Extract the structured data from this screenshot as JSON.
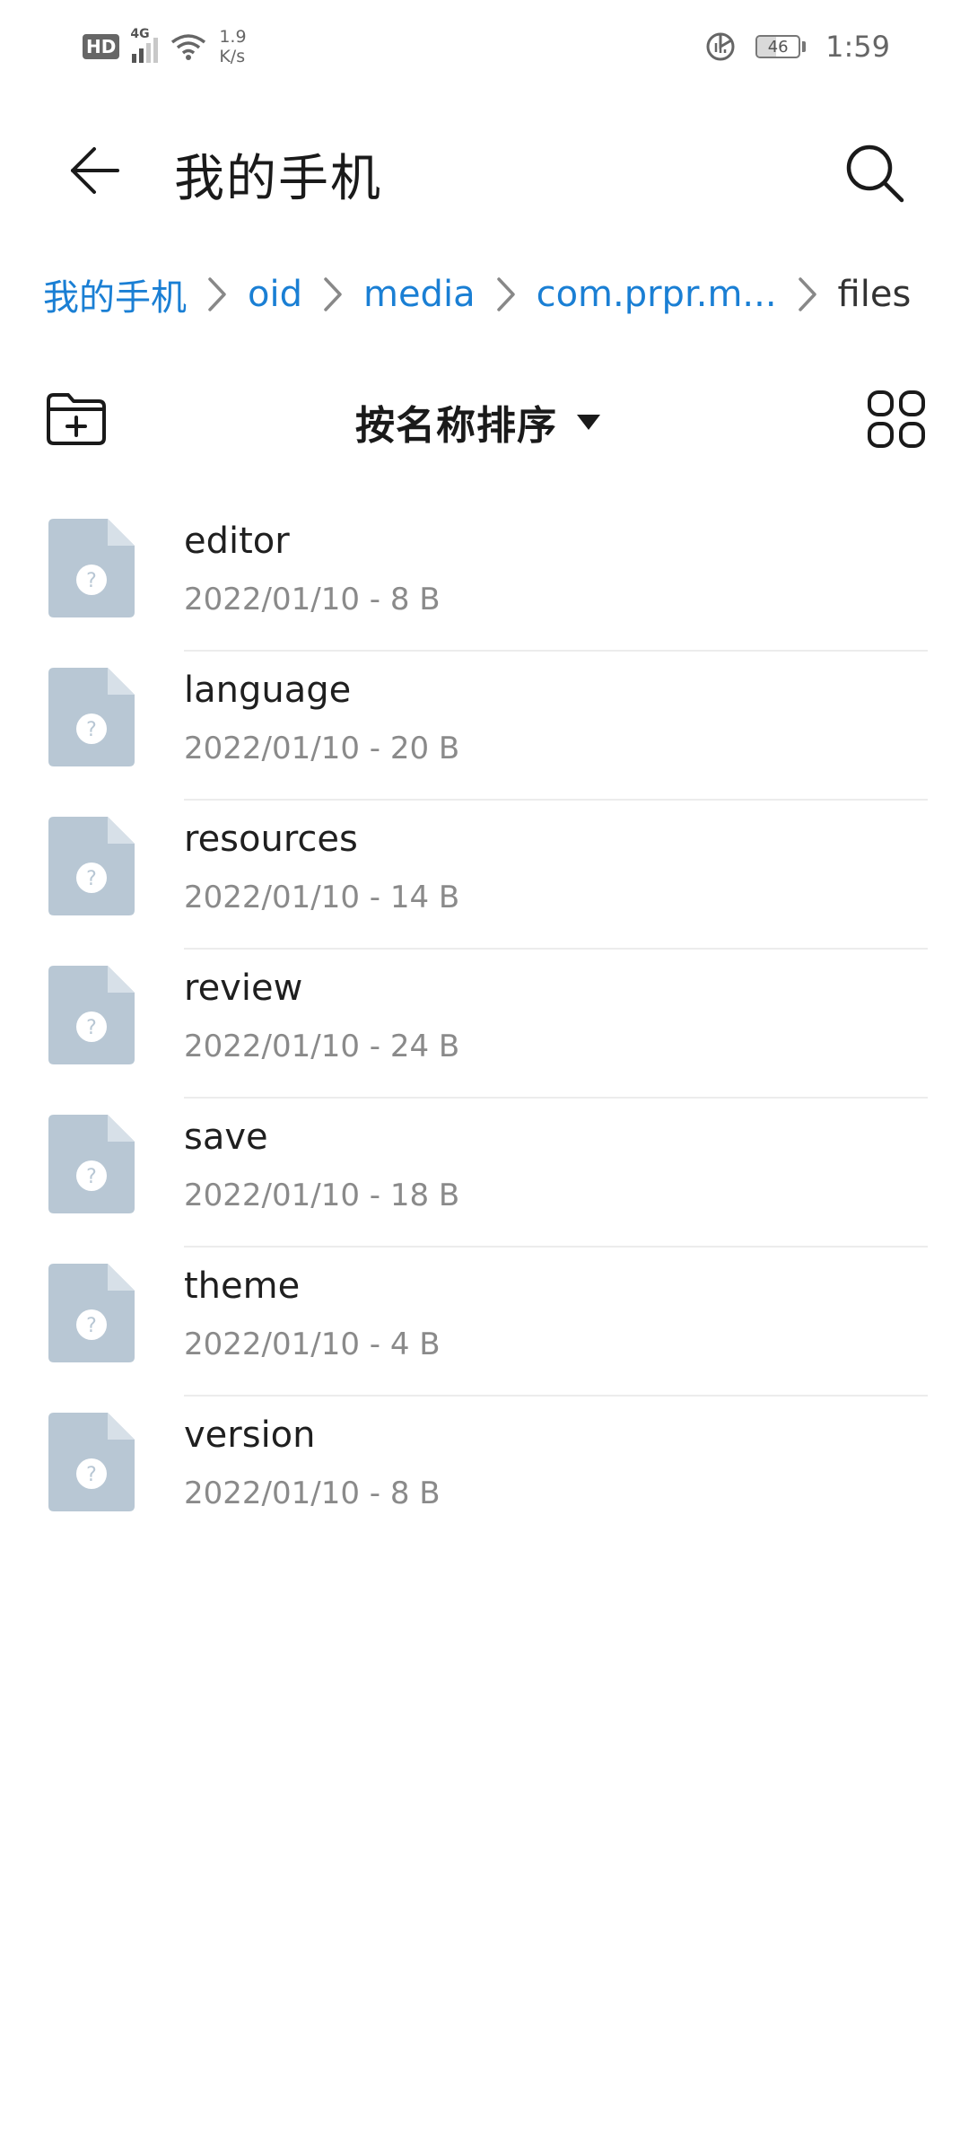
{
  "status_bar": {
    "hd_label": "HD",
    "network_type": "4G",
    "net_speed_value": "1.9",
    "net_speed_unit": "K/s",
    "battery_level": "46",
    "time": "1:59"
  },
  "header": {
    "title": "我的手机"
  },
  "breadcrumb": {
    "items": [
      {
        "label": "我的手机"
      },
      {
        "label": "oid"
      },
      {
        "label": "media"
      },
      {
        "label": "com.prpr.m..."
      },
      {
        "label": "files"
      }
    ]
  },
  "toolbar": {
    "sort_label": "按名称排序"
  },
  "files": [
    {
      "name": "editor",
      "meta": "2022/01/10 - 8 B"
    },
    {
      "name": "language",
      "meta": "2022/01/10 - 20 B"
    },
    {
      "name": "resources",
      "meta": "2022/01/10 - 14 B"
    },
    {
      "name": "review",
      "meta": "2022/01/10 - 24 B"
    },
    {
      "name": "save",
      "meta": "2022/01/10 - 18 B"
    },
    {
      "name": "theme",
      "meta": "2022/01/10 - 4 B"
    },
    {
      "name": "version",
      "meta": "2022/01/10 - 8 B"
    }
  ],
  "icons": {
    "back": "arrow-left-icon",
    "search": "search-icon",
    "new_folder": "folder-add-icon",
    "sort_caret": "caret-down-icon",
    "grid_view": "grid-view-icon",
    "breadcrumb_separator": "chevron-right-icon",
    "file": "unknown-file-icon"
  },
  "colors": {
    "accent": "#1a7fd4",
    "file_icon": "#b8c7d4",
    "text_primary": "#1f1f1f",
    "text_secondary": "#8a8a8a"
  }
}
